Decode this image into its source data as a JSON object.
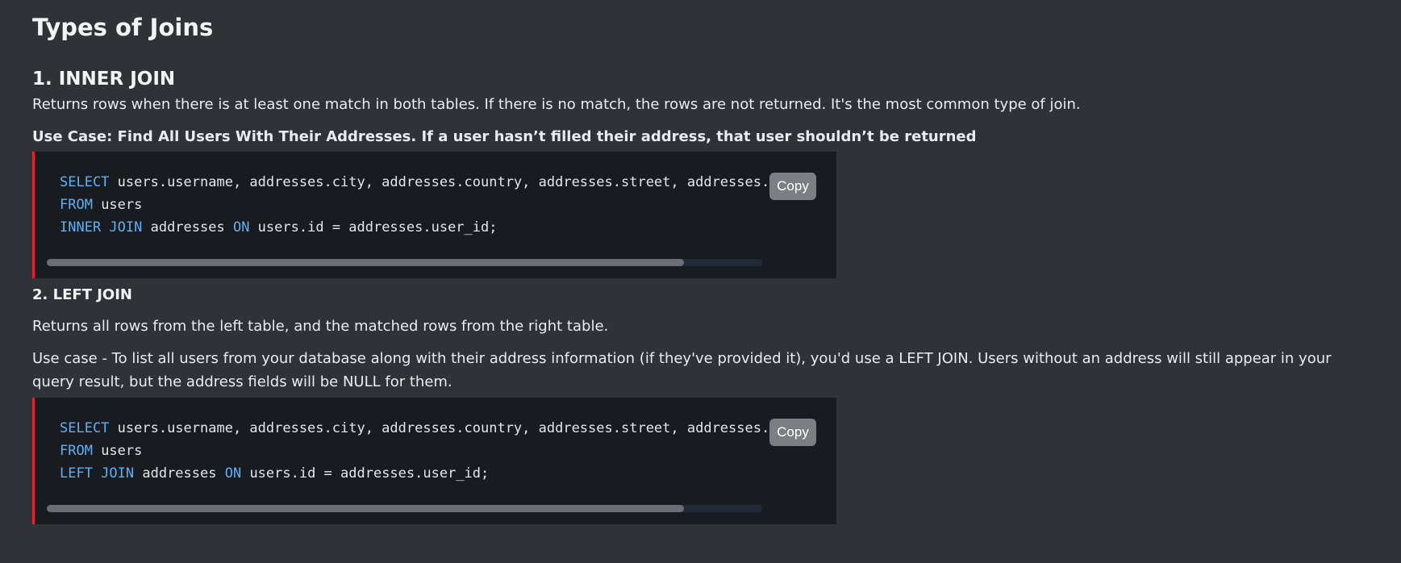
{
  "page_title": "Types of Joins",
  "sections": [
    {
      "heading": "1. INNER JOIN",
      "description": "Returns rows when there is at least one match in both tables. If there is no match, the rows are not returned. It's the most common type of join.",
      "use_case": "Use Case: Find All Users With Their Addresses. If a user hasn’t filled their address, that user shouldn’t be returned",
      "code": {
        "line1_keyword": "SELECT",
        "line1_rest": " users.username, addresses.city, addresses.country, addresses.street, addresses.zipcode",
        "line2_keyword": "FROM",
        "line2_rest": " users",
        "line3_keyword1": "INNER JOIN",
        "line3_mid": " addresses ",
        "line3_keyword2": "ON",
        "line3_rest": " users.id = addresses.user_id;",
        "copy_label": "Copy",
        "scroll_position": 0.0
      }
    },
    {
      "heading": "2. LEFT JOIN",
      "description": "Returns all rows from the left table, and the matched rows from the right table.",
      "use_case": "Use case - To list all users from your database along with their address information (if they've provided it), you'd use a LEFT JOIN. Users without an address will still appear in your query result, but the address fields will be NULL for them.",
      "code": {
        "line1_keyword": "SELECT",
        "line1_rest": " users.username, addresses.city, addresses.country, addresses.street, addresses.zipcode",
        "line2_keyword": "FROM",
        "line2_rest": " users",
        "line3_keyword1": "LEFT JOIN",
        "line3_mid": " addresses ",
        "line3_keyword2": "ON",
        "line3_rest": " users.id = addresses.user_id;",
        "copy_label": "Copy",
        "scroll_position": 0.0
      }
    }
  ],
  "colors": {
    "background": "#2f3337",
    "code_background": "#181b20",
    "code_accent_border": "#e0243a",
    "keyword": "#5fb0f2",
    "copy_button": "#7b7e82"
  }
}
